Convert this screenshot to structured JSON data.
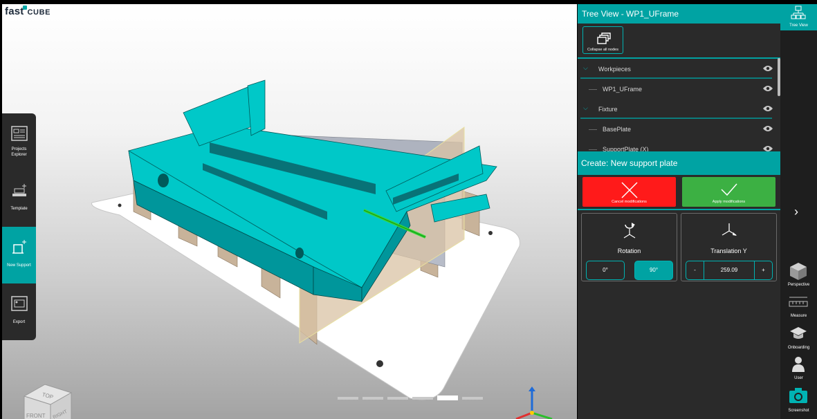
{
  "app": {
    "logo_prefix": "fast",
    "logo_suffix": "CUBE"
  },
  "left_menu": {
    "items": [
      {
        "label_line1": "Projects",
        "label_line2": "Explorer",
        "icon": "projects-explorer-icon"
      },
      {
        "label_line1": "Template",
        "label_line2": "",
        "icon": "template-icon"
      },
      {
        "label_line1": "New Support",
        "label_line2": "",
        "icon": "new-support-icon",
        "active": true
      },
      {
        "label_line1": "Export",
        "label_line2": "",
        "icon": "export-icon"
      }
    ]
  },
  "viewcube": {
    "top": "TOP",
    "front": "FRONT",
    "right": "RIGHT"
  },
  "progress": {
    "steps": 6,
    "current": 5
  },
  "tree_view": {
    "title": "Tree View - WP1_UFrame",
    "collapse_label": "Collapse all nodes",
    "rows": [
      {
        "label": "Workpieces",
        "type": "group"
      },
      {
        "label": "WP1_UFrame",
        "type": "leaf"
      },
      {
        "label": "Fixture",
        "type": "group"
      },
      {
        "label": "BasePlate",
        "type": "leaf"
      },
      {
        "label": "SupportPlate (X)",
        "type": "leaf"
      }
    ]
  },
  "create_panel": {
    "title": "Create: New support plate",
    "cancel_label": "Cancel modifications",
    "apply_label": "Apply modifications",
    "rotation": {
      "title": "Rotation",
      "options": [
        "0°",
        "90°"
      ],
      "selected": "90°"
    },
    "translation": {
      "title": "Translation Y",
      "value": "259.09",
      "minus": "-",
      "plus": "+"
    }
  },
  "toolbar": {
    "items": [
      {
        "label": "Tree View",
        "icon": "tree-view-icon",
        "active": true
      },
      {
        "label": "Perspective",
        "icon": "perspective-cube-icon"
      },
      {
        "label": "Measure",
        "icon": "measure-ruler-icon"
      },
      {
        "label": "Onboarding",
        "icon": "graduation-cap-icon"
      },
      {
        "label": "User",
        "icon": "user-icon"
      },
      {
        "label": "Screenshot",
        "icon": "camera-icon"
      }
    ]
  },
  "colors": {
    "accent": "#00a3a3",
    "cancel": "#ff1a1a",
    "apply": "#3cb043",
    "panel": "#2a2a2a"
  }
}
